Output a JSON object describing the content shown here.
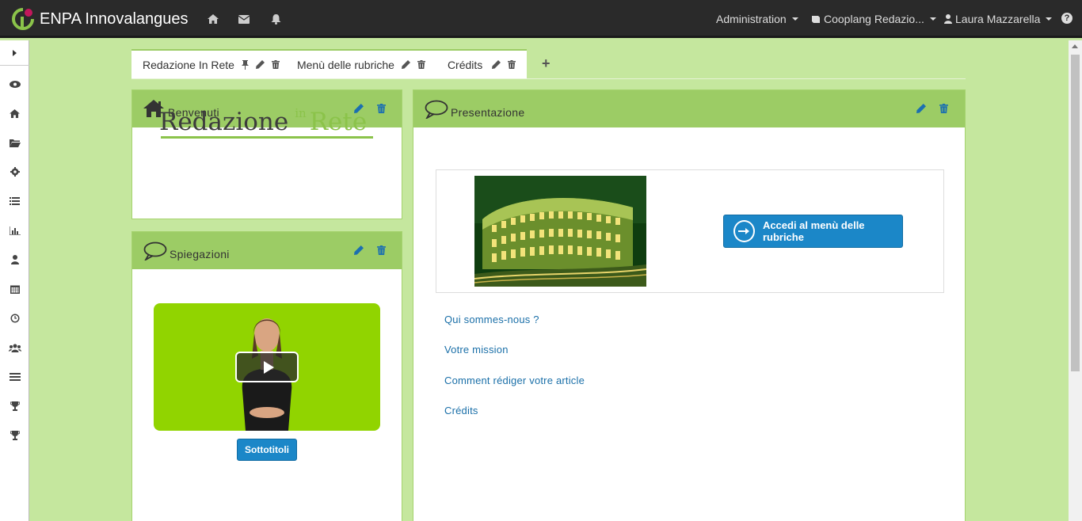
{
  "navbar": {
    "brand": "ENPA Innovalangues",
    "icons": [
      "home-icon",
      "envelope-icon",
      "bell-icon"
    ],
    "menus": [
      {
        "label": "Administration"
      },
      {
        "label": "Cooplang Redazio..."
      },
      {
        "label": "Laura Mazzarella"
      }
    ],
    "help": "?"
  },
  "sidebar": {
    "items": [
      "eye-icon",
      "home-icon",
      "folder-icon",
      "gear-icon",
      "list-icon",
      "chart-icon",
      "user-icon",
      "calendar-icon",
      "clock-icon",
      "users-icon",
      "news-icon",
      "trophy-icon",
      "trophy-icon"
    ]
  },
  "tabs": [
    {
      "label": "Redazione In Rete",
      "active": true
    },
    {
      "label": "Menù delle rubriche"
    },
    {
      "label": "Crédits"
    }
  ],
  "add_tab": "+",
  "panels": {
    "benvenuti": {
      "title": "Benvenuti",
      "logo": {
        "left": "Redazione",
        "in": "in",
        "right": "Rete"
      }
    },
    "spiegazioni": {
      "title": "Spiegazioni",
      "subtitle_button": "Sottotitoli"
    },
    "presentazione": {
      "title": "Presentazione",
      "button": "Accedi al menù delle rubriche",
      "links": [
        "Qui sommes-nous ?",
        "Votre mission",
        "Comment rédiger votre article",
        "Crédits"
      ]
    }
  },
  "colors": {
    "page_bg": "#c5e79e",
    "panel_head": "#9ccc65",
    "primary": "#1b87c8",
    "navbar": "#2a2a2a"
  }
}
